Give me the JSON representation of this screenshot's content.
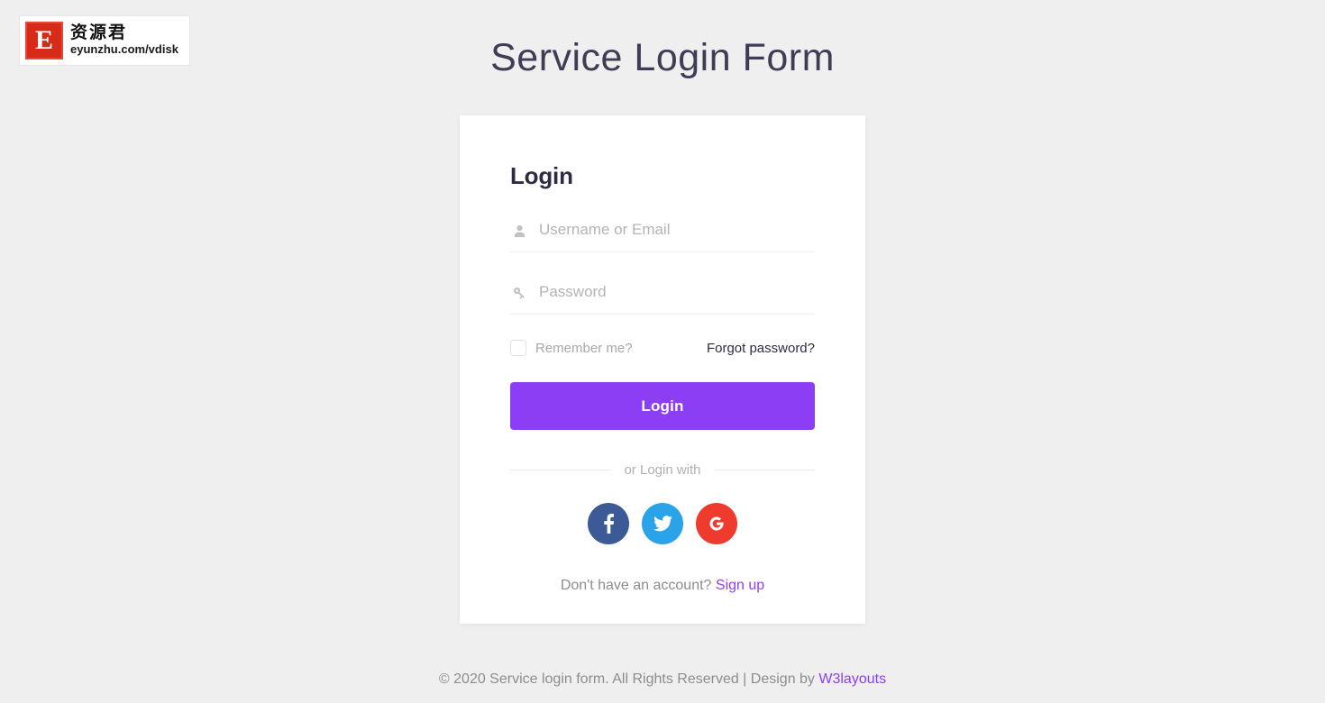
{
  "watermark": {
    "badge_letter": "E",
    "chinese_text": "资源君",
    "url_text": "eyunzhu.com/vdisk"
  },
  "page": {
    "title": "Service Login Form",
    "background_color": "#efefef",
    "accent_color": "#8c3ef5",
    "title_color": "#3f3d56"
  },
  "card": {
    "heading": "Login",
    "username": {
      "icon": "user-icon",
      "placeholder": "Username or Email",
      "value": ""
    },
    "password": {
      "icon": "key-icon",
      "placeholder": "Password",
      "value": ""
    },
    "remember_label": "Remember me?",
    "remember_checked": false,
    "forgot_label": "Forgot password?",
    "submit_label": "Login",
    "divider_label": "or Login with",
    "socials": [
      {
        "name": "facebook",
        "glyph": "f",
        "color": "#3b5a96"
      },
      {
        "name": "twitter",
        "glyph": "twitter-bird",
        "color": "#2ba3e8"
      },
      {
        "name": "google",
        "glyph": "G",
        "color": "#ef3b2d"
      }
    ],
    "signup_prompt": "Don't have an account? ",
    "signup_link": "Sign up"
  },
  "footer": {
    "text": "© 2020 Service login form. All Rights Reserved | Design by ",
    "link": "W3layouts"
  }
}
